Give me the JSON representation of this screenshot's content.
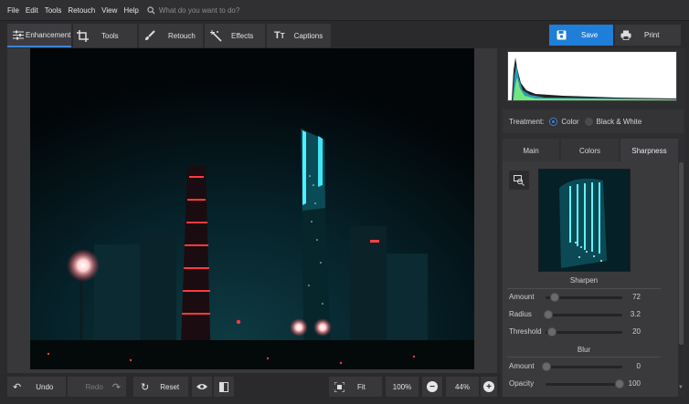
{
  "menu": [
    "File",
    "Edit",
    "Tools",
    "Retouch",
    "View",
    "Help"
  ],
  "search": {
    "placeholder": "What do you want to do?"
  },
  "toolbar": {
    "tabs": [
      {
        "label": "Enhancement",
        "icon": "sliders-icon"
      },
      {
        "label": "Tools",
        "icon": "crop-icon"
      },
      {
        "label": "Retouch",
        "icon": "brush-icon"
      },
      {
        "label": "Effects",
        "icon": "magic-wand-icon"
      },
      {
        "label": "Captions",
        "icon": "text-icon"
      }
    ],
    "active_tab": "Enhancement",
    "save_label": "Save",
    "print_label": "Print"
  },
  "bottom": {
    "undo": "Undo",
    "redo": "Redo",
    "reset": "Reset",
    "fit": "Fit",
    "zoom_actual": "100%",
    "zoom_current": "44%"
  },
  "panel": {
    "treatment_label": "Treatment:",
    "treatment_options": [
      "Color",
      "Black & White"
    ],
    "treatment_selected": "Color",
    "tabs": [
      "Main",
      "Colors",
      "Sharpness"
    ],
    "active_tab": "Sharpness",
    "sharpen": {
      "title": "Sharpen",
      "sliders": [
        {
          "label": "Amount",
          "value": "72"
        },
        {
          "label": "Radius",
          "value": "3.2"
        },
        {
          "label": "Threshold",
          "value": "20"
        }
      ]
    },
    "blur": {
      "title": "Blur",
      "sliders": [
        {
          "label": "Amount",
          "value": "0"
        },
        {
          "label": "Opacity",
          "value": "100"
        }
      ]
    }
  },
  "colors": {
    "accent": "#1f7ed8",
    "bg": "#2b2b2d",
    "panel": "#3a3a3d"
  }
}
